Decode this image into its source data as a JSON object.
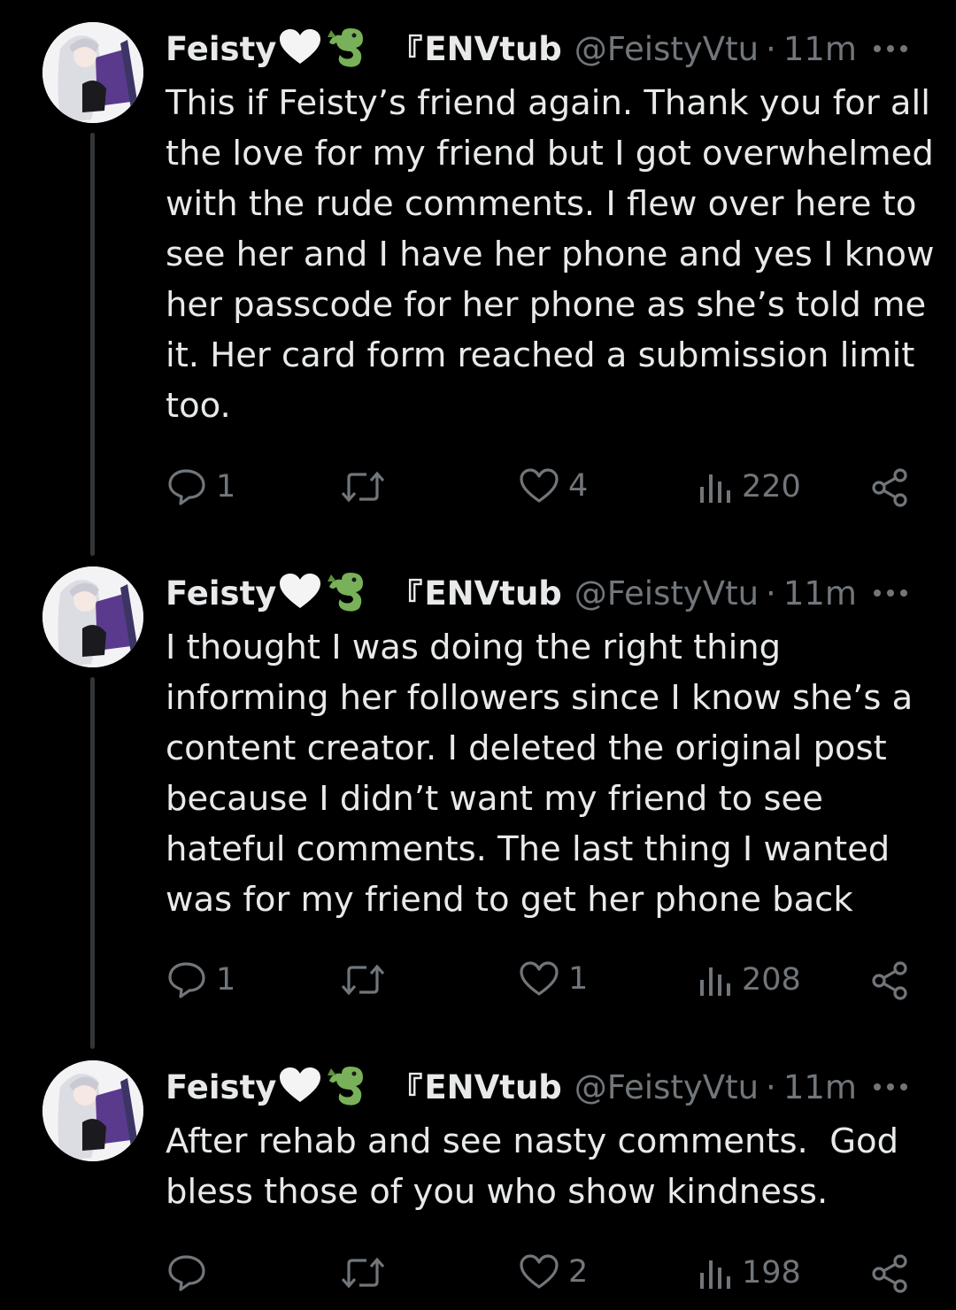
{
  "colors": {
    "background": "#000000",
    "text_primary": "#e7e9ea",
    "text_secondary": "#71767b",
    "thread_line": "#333639"
  },
  "tweets": [
    {
      "display_name": "Feisty",
      "name_emoji": [
        "white-heart-icon",
        "dragon-icon"
      ],
      "name_bracket": "『",
      "name_suffix": "ENVtub",
      "handle": "@FeistyVtu",
      "separator": "·",
      "time": "11m",
      "lines": [
        "This if Feisty’s friend again. Thank you for all",
        "the love for my friend but I got overwhelmed",
        "with the rude comments. I flew over here to",
        "see her and I have her phone and yes I know",
        "her passcode for her phone as she’s told me",
        "it. Her card form reached a submission limit",
        "too."
      ],
      "replies": "1",
      "likes": "4",
      "views": "220"
    },
    {
      "display_name": "Feisty",
      "name_emoji": [
        "white-heart-icon",
        "dragon-icon"
      ],
      "name_bracket": "『",
      "name_suffix": "ENVtub",
      "handle": "@FeistyVtu",
      "separator": "·",
      "time": "11m",
      "lines": [
        "I thought I was doing the right thing",
        "informing her followers since I know she’s a",
        "content creator. I deleted the original post",
        "because I didn’t want my friend to see",
        "hateful comments. The last thing I wanted",
        "was for my friend to get her phone back"
      ],
      "replies": "1",
      "likes": "1",
      "views": "208"
    },
    {
      "display_name": "Feisty",
      "name_emoji": [
        "white-heart-icon",
        "dragon-icon"
      ],
      "name_bracket": "『",
      "name_suffix": "ENVtub",
      "handle": "@FeistyVtu",
      "separator": "·",
      "time": "11m",
      "lines": [
        "After rehab and see nasty comments.  God",
        "bless those of you who show kindness."
      ],
      "replies": "",
      "likes": "2",
      "views": "198"
    }
  ]
}
